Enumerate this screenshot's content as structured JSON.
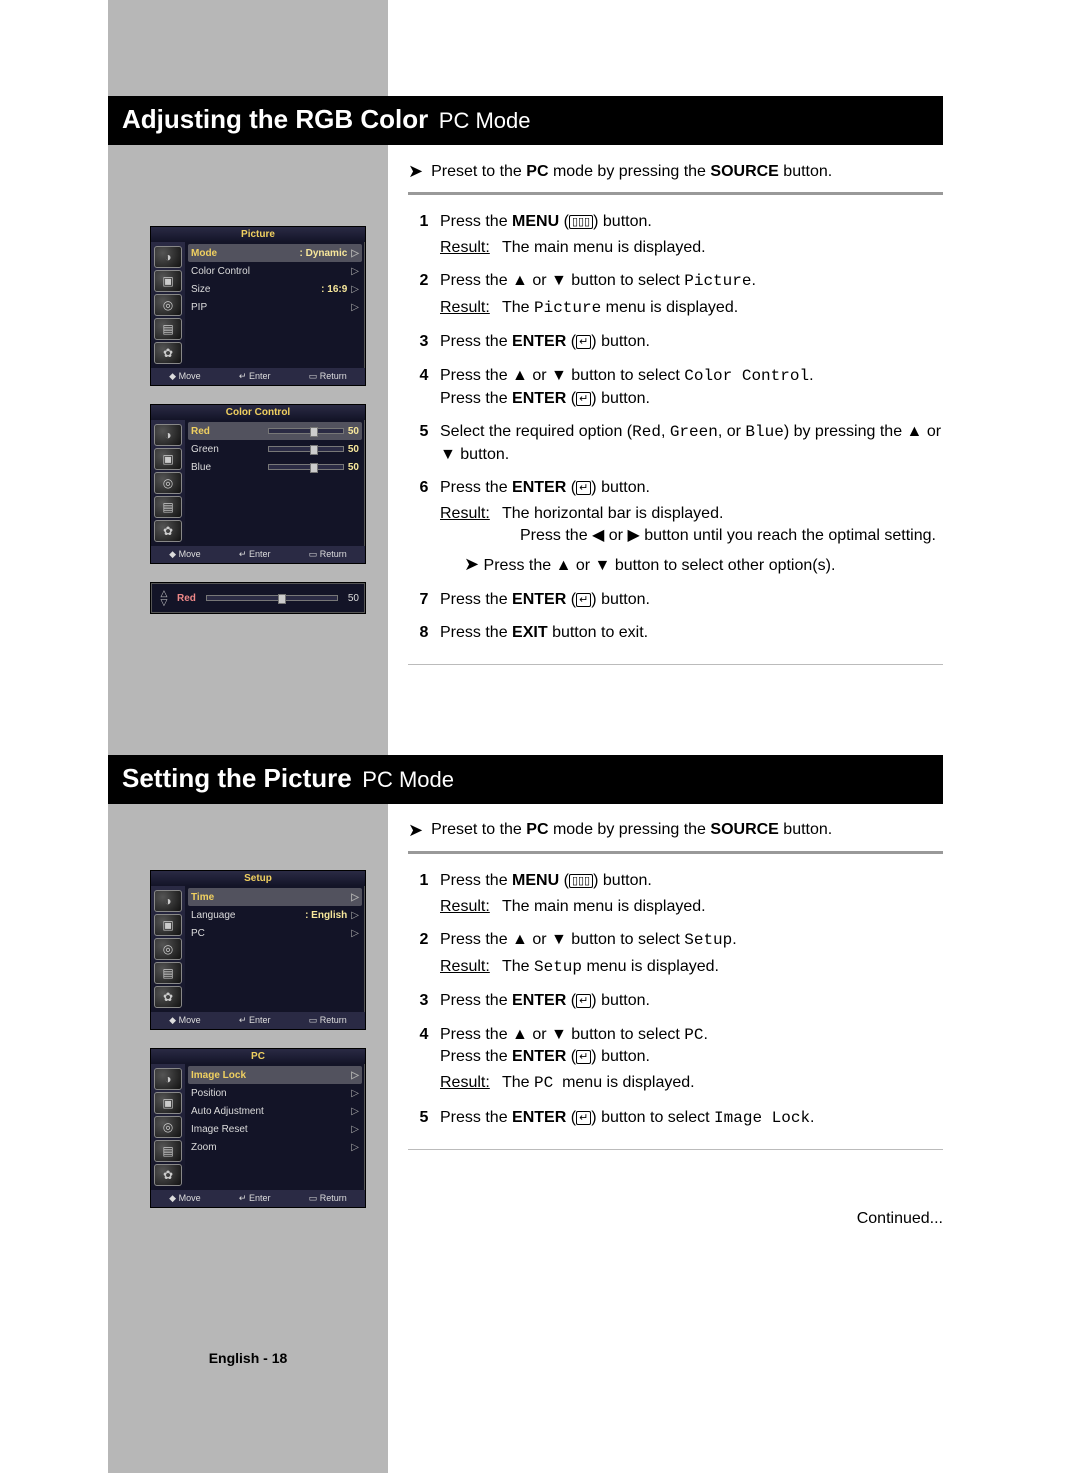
{
  "section1": {
    "title_bold": "Adjusting the RGB Color",
    "title_sub": "PC Mode",
    "preset_prefix": "Preset to the",
    "preset_pc": "PC",
    "preset_mid": "mode by pressing the",
    "preset_source": "SOURCE",
    "preset_suffix": "button.",
    "result_label": "Result:",
    "steps": {
      "s1a": "Press the",
      "s1b": "MENU",
      "s1c": "button.",
      "s1r": "The main menu is displayed.",
      "s2a": "Press the ▲ or ▼ button to select",
      "s2b": "Picture",
      "s2r_a": "The",
      "s2r_b": "Picture",
      "s2r_c": "menu is displayed.",
      "s3a": "Press the",
      "s3b": "ENTER",
      "s3c": "button.",
      "s4a": "Press the ▲ or ▼ button to select",
      "s4b": "Color Control",
      "s4c": "Press the",
      "s4d": "ENTER",
      "s4e": "button.",
      "s5a": "Select the required option (",
      "s5b": "Red",
      "s5c": "Green",
      "s5d": "Blue",
      "s5e": ") by pressing the ▲ or ▼ button.",
      "s6a": "Press the",
      "s6b": "ENTER",
      "s6c": "button.",
      "s6r1": "The horizontal bar is displayed.",
      "s6r2": "Press the ◀ or ▶ button until you reach the optimal setting.",
      "s6note": "Press the ▲ or ▼ button to select other option(s).",
      "s7a": "Press the",
      "s7b": "ENTER",
      "s7c": "button.",
      "s8a": "Press the",
      "s8b": "EXIT",
      "s8c": "button to exit."
    }
  },
  "section2": {
    "title_bold": "Setting the Picture",
    "title_sub": "PC Mode",
    "preset_prefix": "Preset to the",
    "preset_pc": "PC",
    "preset_mid": "mode by pressing the",
    "preset_source": "SOURCE",
    "preset_suffix": "button.",
    "result_label": "Result:",
    "steps": {
      "s1a": "Press the",
      "s1b": "MENU",
      "s1c": "button.",
      "s1r": "The main menu is displayed.",
      "s2a": "Press the ▲ or ▼ button to select",
      "s2b": "Setup",
      "s2r_a": "The",
      "s2r_b": "Setup",
      "s2r_c": "menu is displayed.",
      "s3a": "Press the",
      "s3b": "ENTER",
      "s3c": "button.",
      "s4a": "Press the ▲ or ▼ button to select",
      "s4b": "PC",
      "s4c": "Press the",
      "s4d": "ENTER",
      "s4e": "button.",
      "s4r_a": "The",
      "s4r_b": "PC",
      "s4r_c": "menu is displayed.",
      "s5a": "Press the",
      "s5b": "ENTER",
      "s5c": "button to select",
      "s5d": "Image Lock"
    },
    "continued": "Continued..."
  },
  "osd": {
    "picture": {
      "title": "Picture",
      "rows": [
        {
          "label": "Mode",
          "value": ": Dynamic"
        },
        {
          "label": "Color Control",
          "value": ""
        },
        {
          "label": "Size",
          "value": ": 16:9"
        },
        {
          "label": "PIP",
          "value": ""
        }
      ],
      "footer": {
        "move": "◆ Move",
        "enter": "↵ Enter",
        "return": "▭ Return"
      }
    },
    "colorcontrol": {
      "title": "Color Control",
      "rows": [
        {
          "label": "Red",
          "value": "50"
        },
        {
          "label": "Green",
          "value": "50"
        },
        {
          "label": "Blue",
          "value": "50"
        }
      ],
      "footer": {
        "move": "◆ Move",
        "enter": "↵ Enter",
        "return": "▭ Return"
      }
    },
    "redadjust": {
      "label": "Red",
      "value": "50"
    },
    "setup": {
      "title": "Setup",
      "rows": [
        {
          "label": "Time",
          "value": ""
        },
        {
          "label": "Language",
          "value": ": English"
        },
        {
          "label": "PC",
          "value": ""
        }
      ],
      "footer": {
        "move": "◆ Move",
        "enter": "↵ Enter",
        "return": "▭ Return"
      }
    },
    "pc": {
      "title": "PC",
      "rows": [
        {
          "label": "Image Lock",
          "value": ""
        },
        {
          "label": "Position",
          "value": ""
        },
        {
          "label": "Auto Adjustment",
          "value": ""
        },
        {
          "label": "Image Reset",
          "value": ""
        },
        {
          "label": "Zoom",
          "value": ""
        }
      ],
      "footer": {
        "move": "◆ Move",
        "enter": "↵ Enter",
        "return": "▭ Return"
      }
    }
  },
  "footer": {
    "text": "English - 18"
  }
}
